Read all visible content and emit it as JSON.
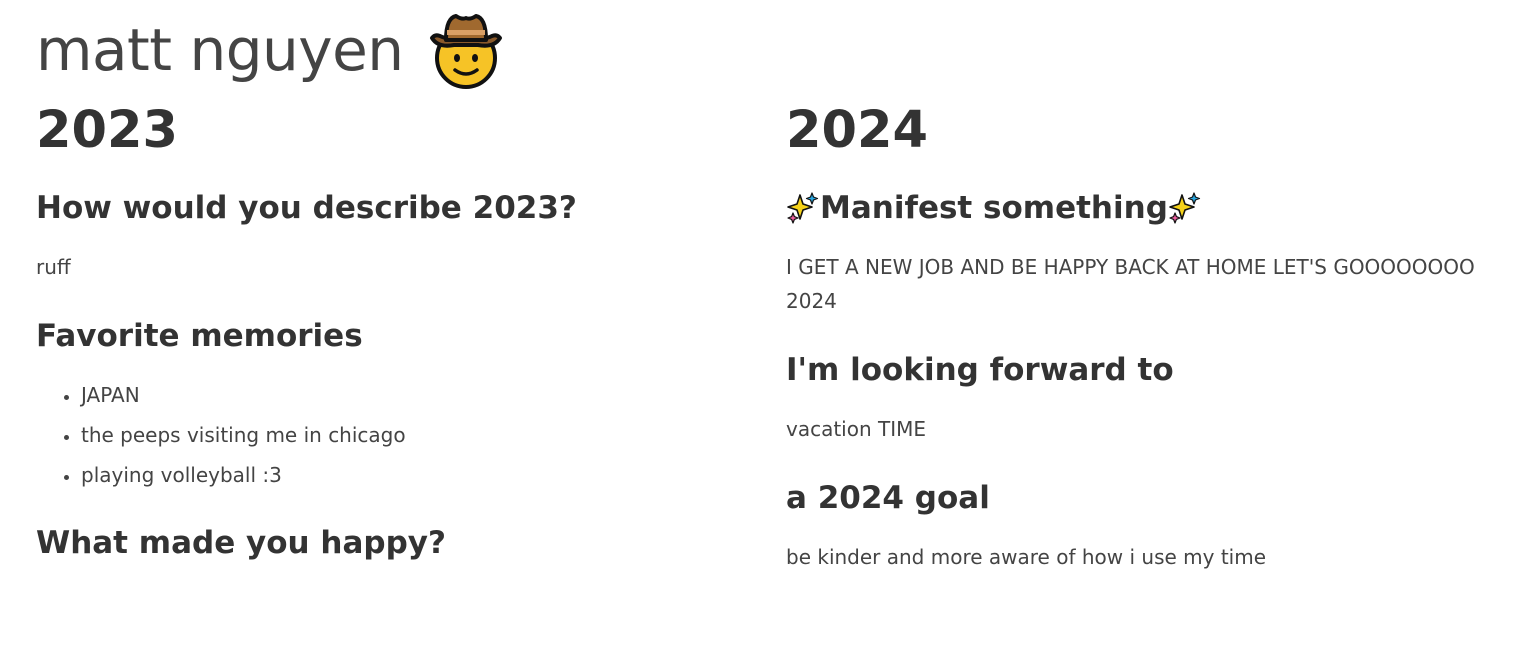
{
  "header": {
    "title": "matt nguyen",
    "title_icon": "cowboy-face-icon"
  },
  "left": {
    "year": "2023",
    "q1": "How would you describe 2023?",
    "a1": "ruff",
    "q2": "Favorite memories",
    "memories": [
      "JAPAN",
      "the peeps visiting me in chicago",
      "playing volleyball :3"
    ],
    "q3": "What made you happy?"
  },
  "right": {
    "year": "2024",
    "q1": "Manifest something",
    "q1_icon": "sparkles-icon",
    "a1": "I GET A NEW JOB AND BE HAPPY BACK AT HOME LET'S GOOOOOOOO 2024",
    "q2": "I'm looking forward to",
    "a2": "vacation TIME",
    "q3": "a 2024 goal",
    "a3": "be kinder and more aware of how i use my time"
  },
  "colors": {
    "text": "#333333",
    "muted": "#444444",
    "background": "#ffffff"
  }
}
